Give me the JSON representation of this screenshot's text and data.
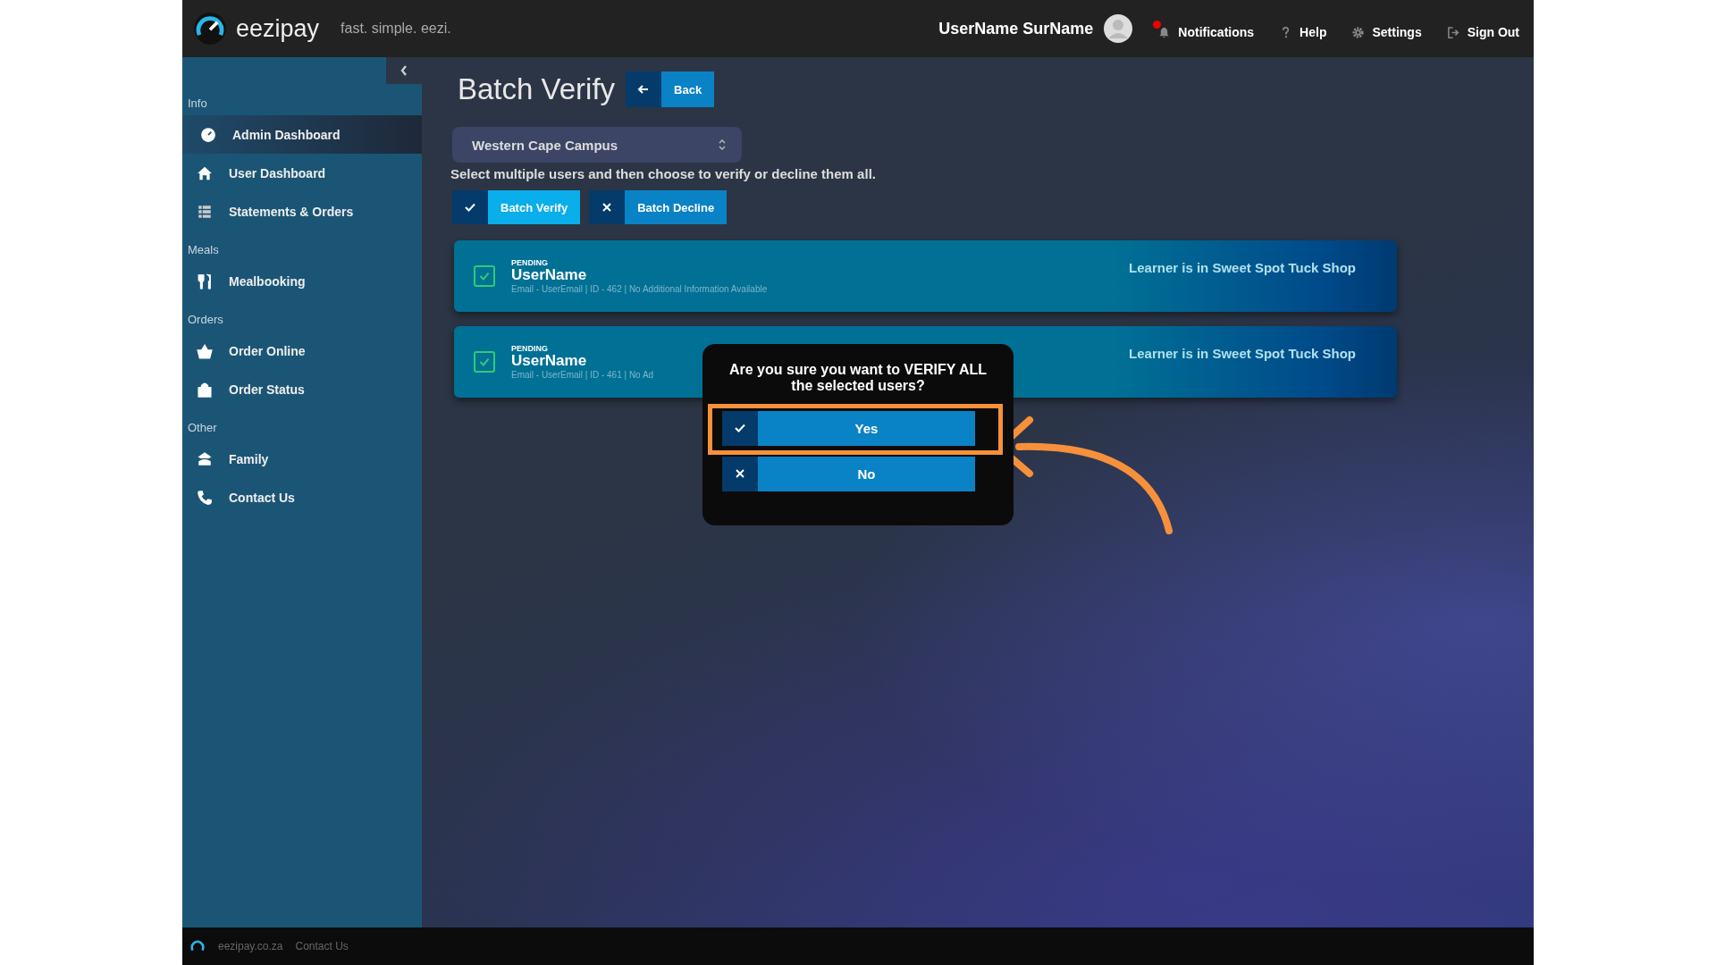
{
  "header": {
    "brand": "eezipay",
    "tagline": "fast. simple. eezi.",
    "user": "UserName SurName",
    "notifications_unread": true,
    "links": [
      {
        "label": "Notifications"
      },
      {
        "label": "Help"
      },
      {
        "label": "Settings"
      },
      {
        "label": "Sign Out"
      }
    ]
  },
  "sidebar": {
    "sections": [
      {
        "title": "Info",
        "items": [
          {
            "label": "Admin Dashboard",
            "selected": true
          },
          {
            "label": "User Dashboard",
            "selected": false
          },
          {
            "label": "Statements & Orders",
            "selected": false
          }
        ]
      },
      {
        "title": "Meals",
        "items": [
          {
            "label": "Mealbooking",
            "selected": false
          }
        ]
      },
      {
        "title": "Orders",
        "items": [
          {
            "label": "Order Online",
            "selected": false
          },
          {
            "label": "Order Status",
            "selected": false
          }
        ]
      },
      {
        "title": "Other",
        "items": [
          {
            "label": "Family",
            "selected": false
          },
          {
            "label": "Contact Us",
            "selected": false
          }
        ]
      }
    ]
  },
  "page": {
    "title": "Batch Verify",
    "back": "Back",
    "campus": "Western Cape Campus",
    "instructions": "Select multiple users and then choose to verify or decline them all.",
    "actions": [
      {
        "label": "Batch Verify",
        "kind": "verify"
      },
      {
        "label": "Batch Decline",
        "kind": "decline"
      }
    ],
    "users": [
      {
        "status": "PENDING",
        "name": "UserName",
        "details": "Email - UserEmail | ID - 462 | No Additional Information Available",
        "location": "Learner is in Sweet Spot Tuck Shop",
        "checked": true
      },
      {
        "status": "PENDING",
        "name": "UserName",
        "details": "Email - UserEmail | ID - 461 | No Ad",
        "location": "Learner is in Sweet Spot Tuck Shop",
        "checked": true
      }
    ]
  },
  "dialog": {
    "message": "Are you sure you want to VERIFY ALL the selected users?",
    "buttons": [
      {
        "label": "Yes",
        "kind": "confirm",
        "highlighted": true
      },
      {
        "label": "No",
        "kind": "cancel",
        "highlighted": false
      }
    ]
  },
  "footer": {
    "links": [
      "eezipay.co.za",
      "Contact Us"
    ]
  }
}
